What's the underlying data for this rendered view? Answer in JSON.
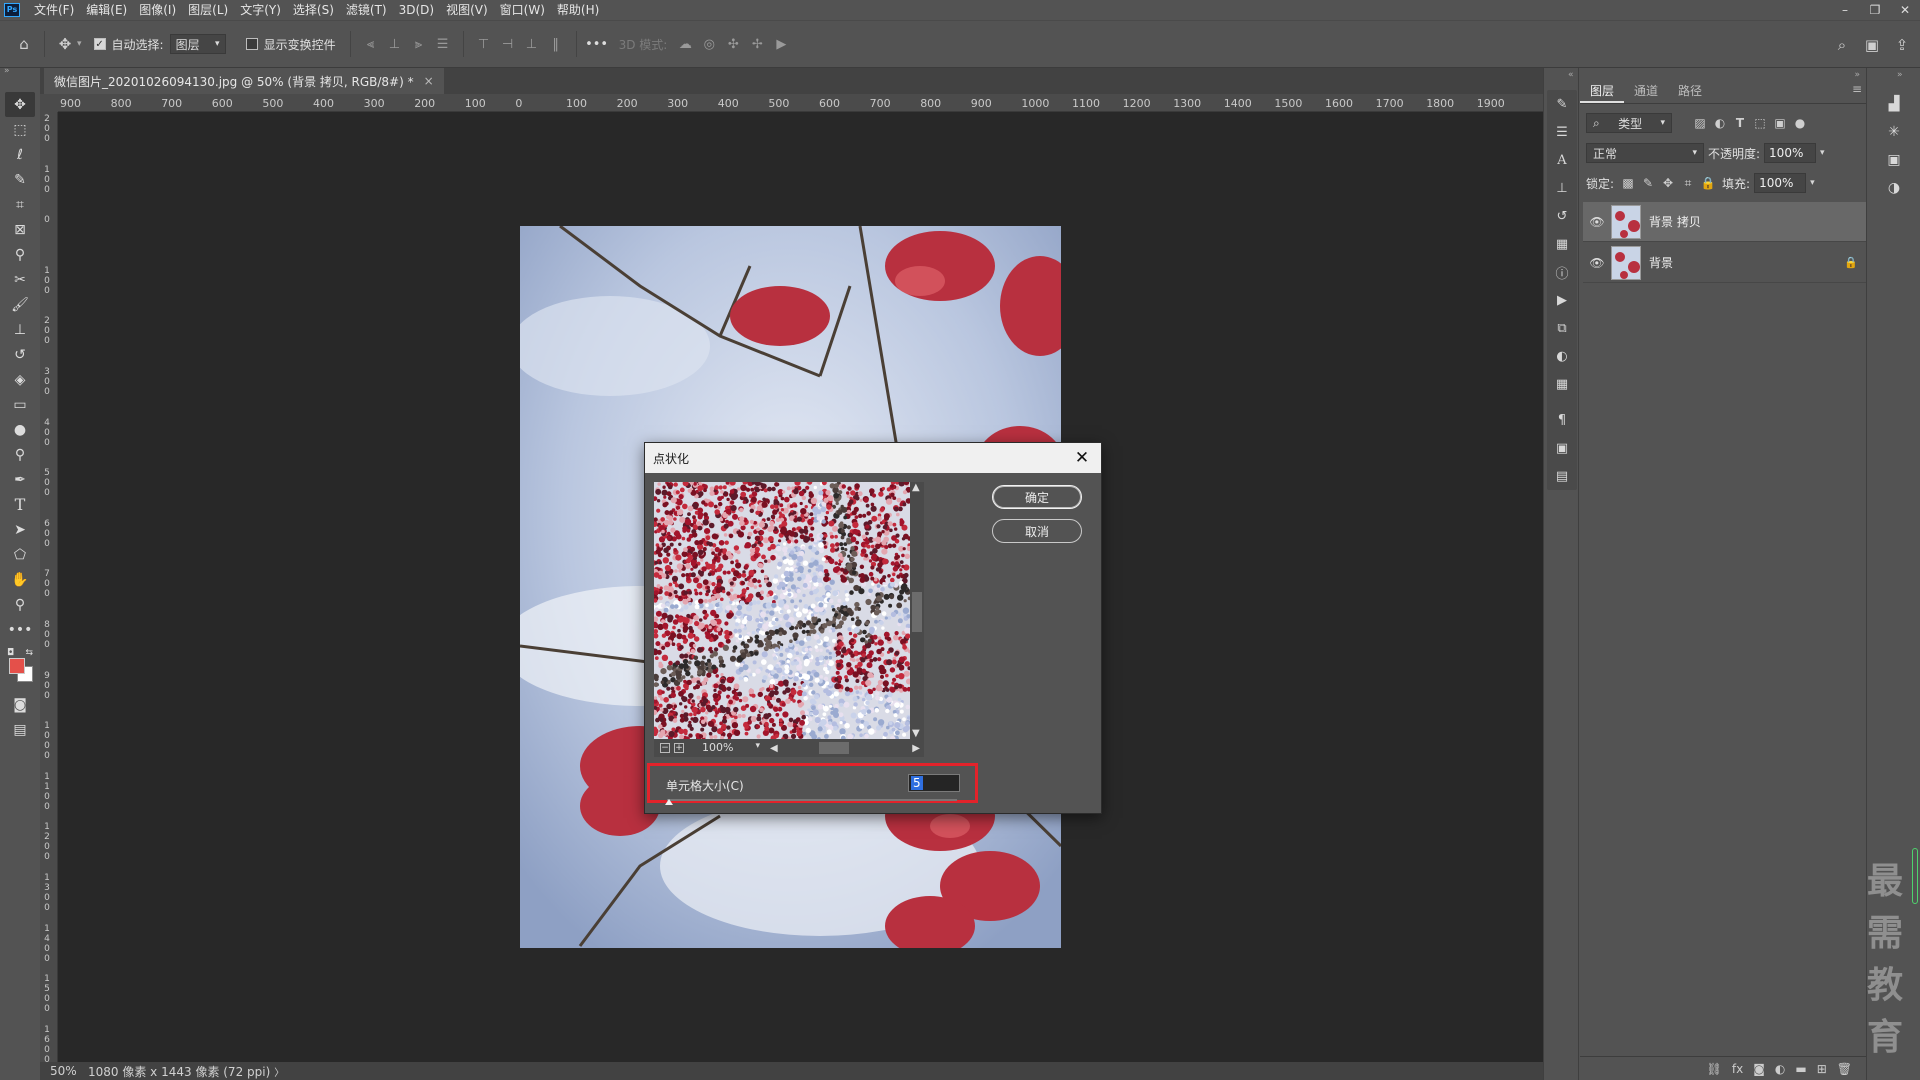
{
  "app": {
    "logo": "Ps"
  },
  "menu": [
    "文件(F)",
    "编辑(E)",
    "图像(I)",
    "图层(L)",
    "文字(Y)",
    "选择(S)",
    "滤镜(T)",
    "3D(D)",
    "视图(V)",
    "窗口(W)",
    "帮助(H)"
  ],
  "options": {
    "auto_select_label": "自动选择:",
    "auto_select_value": "图层",
    "show_transform_label": "显示变换控件",
    "mode_3d_label": "3D 模式:"
  },
  "document": {
    "tab_title": "微信图片_20201026094130.jpg @ 50% (背景 拷贝, RGB/8#) *",
    "zoom": "50%",
    "info": "1080 像素 x 1443 像素 (72 ppi)"
  },
  "ruler": {
    "h_ticks": [
      "900",
      "800",
      "700",
      "600",
      "500",
      "400",
      "300",
      "200",
      "100",
      "0",
      "100",
      "200",
      "300",
      "400",
      "500",
      "600",
      "700",
      "800",
      "900",
      "1000",
      "1100",
      "1200",
      "1300",
      "1400",
      "1500",
      "1600",
      "1700",
      "1800",
      "1900"
    ],
    "v_ticks": [
      "2\n0\n0",
      "1\n0\n0",
      "0",
      "1\n0\n0",
      "2\n0\n0",
      "3\n0\n0",
      "4\n0\n0",
      "5\n0\n0",
      "6\n0\n0",
      "7\n0\n0",
      "8\n0\n0",
      "9\n0\n0",
      "1\n0\n0\n0",
      "1\n1\n0\n0",
      "1\n2\n0\n0",
      "1\n3\n0\n0",
      "1\n4\n0\n0",
      "1\n5\n0\n0",
      "1\n6\n0\n0"
    ]
  },
  "dialog": {
    "title": "点状化",
    "ok_label": "确定",
    "cancel_label": "取消",
    "preview_zoom": "100%",
    "cell_size_label": "单元格大小(C)",
    "cell_size_value": "5",
    "cell_size_min": 3,
    "cell_size_max": 300
  },
  "layers_panel": {
    "tabs": [
      "图层",
      "通道",
      "路径"
    ],
    "filter_label": "类型",
    "blend_mode": "正常",
    "opacity_label": "不透明度:",
    "opacity_value": "100%",
    "lock_label": "锁定:",
    "fill_label": "填充:",
    "fill_value": "100%",
    "layers": [
      {
        "name": "背景 拷贝",
        "selected": true,
        "locked": false
      },
      {
        "name": "背景",
        "selected": false,
        "locked": true
      }
    ]
  },
  "colors": {
    "foreground": "#e4504a",
    "background": "#ffffff",
    "highlight_box": "#e3232b"
  },
  "watermark": "最需教育"
}
